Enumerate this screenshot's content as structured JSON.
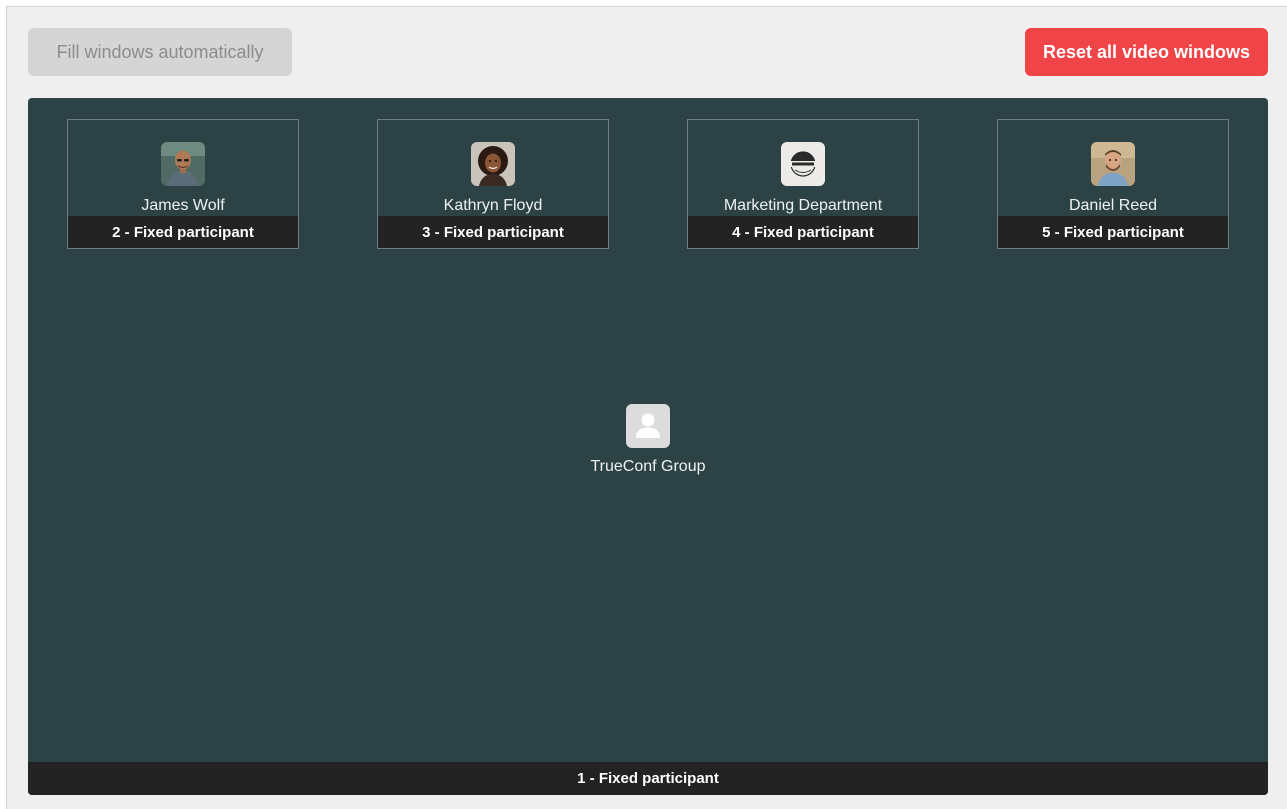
{
  "toolbar": {
    "fill_label": "Fill windows automatically",
    "reset_label": "Reset all video windows",
    "reset_color": "#ef4548"
  },
  "tiles": [
    {
      "name": "James Wolf",
      "slot": "2 - Fixed participant",
      "avatar": "photo-man-bald"
    },
    {
      "name": "Kathryn Floyd",
      "slot": "3 - Fixed participant",
      "avatar": "photo-woman-curly-hair"
    },
    {
      "name": "Marketing Department",
      "slot": "4 - Fixed participant",
      "avatar": "marketing-logo"
    },
    {
      "name": "Daniel Reed",
      "slot": "5 - Fixed participant",
      "avatar": "photo-man-beard"
    }
  ],
  "main": {
    "name": "TrueConf Group",
    "slot": "1 - Fixed participant",
    "avatar": "user-placeholder-icon"
  },
  "colors": {
    "stage_background": "#2c4245",
    "label_bar": "#232323"
  }
}
